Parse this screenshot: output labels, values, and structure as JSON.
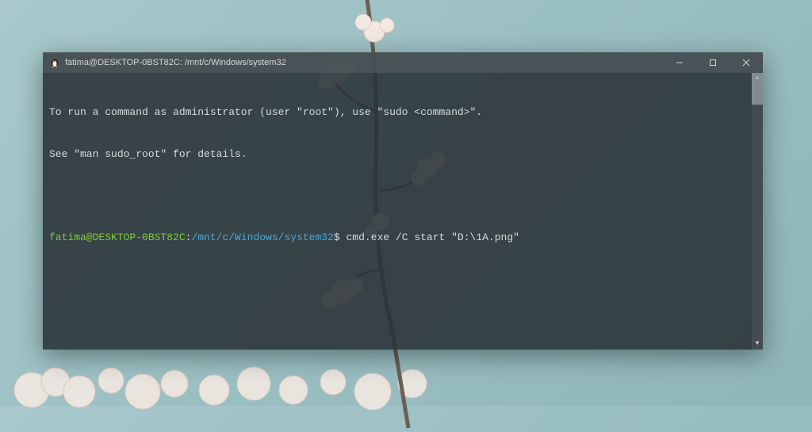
{
  "window": {
    "icon": "penguin-icon",
    "title": "fatima@DESKTOP-0BST82C: /mnt/c/Windows/system32"
  },
  "terminal": {
    "motd_line1": "To run a command as administrator (user \"root\"), use \"sudo <command>\".",
    "motd_line2": "See \"man sudo_root\" for details.",
    "prompt_user": "fatima@DESKTOP-0BST82C",
    "prompt_colon": ":",
    "prompt_path": "/mnt/c/Windows/system32",
    "prompt_dollar": "$",
    "command": " cmd.exe /C start \"D:\\1A.png\""
  },
  "colors": {
    "terminal_bg": "rgba(40,49,53,0.88)",
    "user_color": "#7fcf2f",
    "path_color": "#4aa8e0",
    "text_color": "#d7dbdd"
  }
}
